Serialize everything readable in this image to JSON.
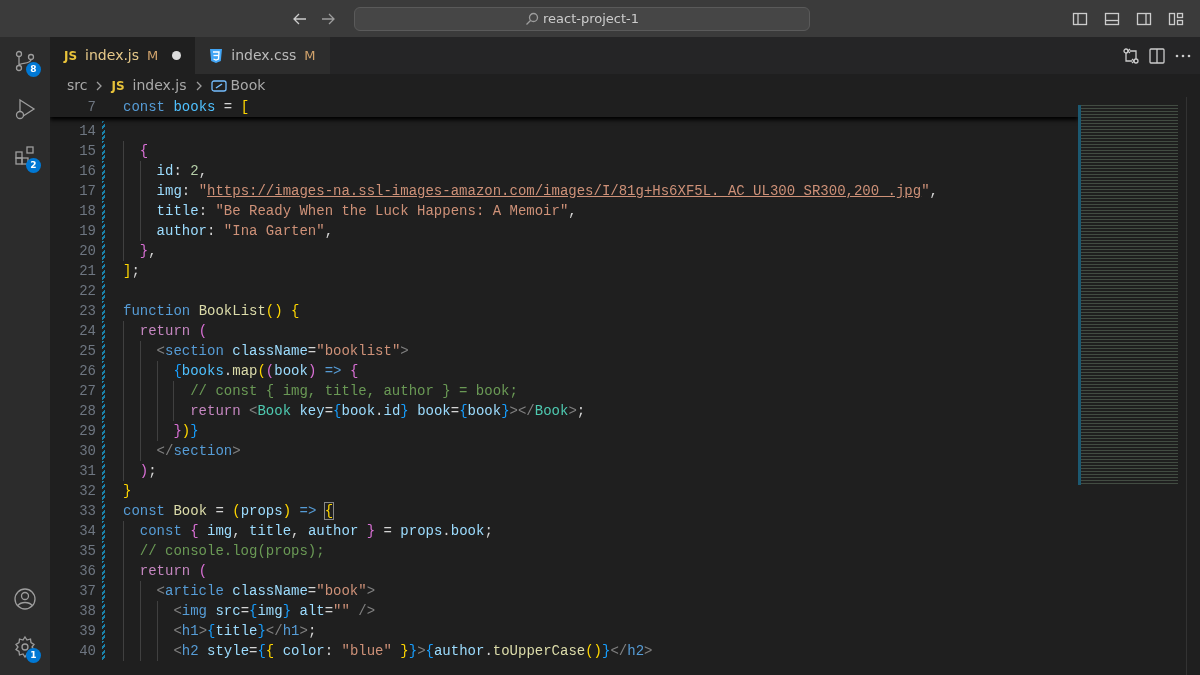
{
  "title_bar": {
    "search": {
      "value": "react-project-1"
    }
  },
  "activity_bar": {
    "top": [
      {
        "kind": "source-control",
        "badge": "8"
      },
      {
        "kind": "run-debug"
      },
      {
        "kind": "extensions",
        "badge": "2"
      }
    ],
    "bottom": [
      {
        "kind": "account"
      },
      {
        "kind": "settings",
        "badge": "1"
      }
    ]
  },
  "tabs": [
    {
      "kind": "js",
      "icon_text": "JS",
      "label": "index.js",
      "status": "M",
      "dirty": true,
      "selected": true
    },
    {
      "kind": "css",
      "label": "index.css",
      "status": "M",
      "dirty": false,
      "selected": false
    }
  ],
  "breadcrumb": [
    {
      "kind": "folder",
      "label": "src"
    },
    {
      "kind": "js",
      "icon_text": "JS",
      "label": "index.js"
    },
    {
      "kind": "symbol",
      "label": "Book"
    }
  ],
  "sticky_line": {
    "number": "7",
    "tokens": [
      {
        "text": "const ",
        "kind": "kw"
      },
      {
        "text": "books",
        "kind": "cnst"
      },
      {
        "text": " = ",
        "kind": "p"
      },
      {
        "text": "[",
        "kind": "b1"
      }
    ]
  },
  "lines": [
    {
      "number": "14",
      "modified": true
    },
    {
      "number": "15",
      "modified": true,
      "tokens": [
        {
          "text": "  {",
          "kind": "b2"
        }
      ]
    },
    {
      "number": "16",
      "modified": true,
      "tokens": [
        {
          "text": "    id",
          "kind": "var"
        },
        {
          "text": ": ",
          "kind": "p"
        },
        {
          "text": "2",
          "kind": "num"
        },
        {
          "text": ",",
          "kind": "p"
        }
      ]
    },
    {
      "number": "17",
      "modified": true,
      "tokens": [
        {
          "text": "    img",
          "kind": "var"
        },
        {
          "text": ": ",
          "kind": "p"
        },
        {
          "text": "\"",
          "kind": "str"
        },
        {
          "text": "https://images-na.ssl-images-amazon.com/images/I/81g+Hs6XF5L._AC_UL300_SR300,200_.jpg",
          "kind": "link"
        },
        {
          "text": "\"",
          "kind": "str"
        },
        {
          "text": ",",
          "kind": "p"
        }
      ]
    },
    {
      "number": "18",
      "modified": true,
      "tokens": [
        {
          "text": "    title",
          "kind": "var"
        },
        {
          "text": ": ",
          "kind": "p"
        },
        {
          "text": "\"Be Ready When the Luck Happens: A Memoir\"",
          "kind": "str"
        },
        {
          "text": ",",
          "kind": "p"
        }
      ]
    },
    {
      "number": "19",
      "modified": true,
      "tokens": [
        {
          "text": "    author",
          "kind": "var"
        },
        {
          "text": ": ",
          "kind": "p"
        },
        {
          "text": "\"Ina Garten\"",
          "kind": "str"
        },
        {
          "text": ",",
          "kind": "p"
        }
      ]
    },
    {
      "number": "20",
      "modified": true,
      "tokens": [
        {
          "text": "  }",
          "kind": "b2"
        },
        {
          "text": ",",
          "kind": "p"
        }
      ]
    },
    {
      "number": "21",
      "modified": true,
      "tokens": [
        {
          "text": "]",
          "kind": "b1"
        },
        {
          "text": ";",
          "kind": "p"
        }
      ]
    },
    {
      "number": "22",
      "modified": true
    },
    {
      "number": "23",
      "modified": true,
      "tokens": [
        {
          "text": "function ",
          "kind": "kw"
        },
        {
          "text": "BookList",
          "kind": "fn"
        },
        {
          "text": "() {",
          "kind": "b1"
        }
      ]
    },
    {
      "number": "24",
      "modified": true,
      "tokens": [
        {
          "text": "  return ",
          "kind": "ctl"
        },
        {
          "text": "(",
          "kind": "b2"
        }
      ]
    },
    {
      "number": "25",
      "modified": true,
      "tokens": [
        {
          "text": "    <",
          "kind": "tagp"
        },
        {
          "text": "section ",
          "kind": "tag"
        },
        {
          "text": "className",
          "kind": "var"
        },
        {
          "text": "=",
          "kind": "p"
        },
        {
          "text": "\"booklist\"",
          "kind": "str"
        },
        {
          "text": ">",
          "kind": "tagp"
        }
      ]
    },
    {
      "number": "26",
      "modified": true,
      "tokens": [
        {
          "text": "      {",
          "kind": "b3"
        },
        {
          "text": "books",
          "kind": "cnst"
        },
        {
          "text": ".",
          "kind": "p"
        },
        {
          "text": "map",
          "kind": "fn"
        },
        {
          "text": "(",
          "kind": "b1"
        },
        {
          "text": "(",
          "kind": "b2"
        },
        {
          "text": "book",
          "kind": "var"
        },
        {
          "text": ") ",
          "kind": "b2"
        },
        {
          "text": "=> ",
          "kind": "kw"
        },
        {
          "text": "{",
          "kind": "b2"
        }
      ]
    },
    {
      "number": "27",
      "modified": true,
      "tokens": [
        {
          "text": "        // const { img, title, author } = book;",
          "kind": "cmt"
        }
      ]
    },
    {
      "number": "28",
      "modified": true,
      "tokens": [
        {
          "text": "        return ",
          "kind": "ctl"
        },
        {
          "text": "<",
          "kind": "tagp"
        },
        {
          "text": "Book ",
          "kind": "comp"
        },
        {
          "text": "key",
          "kind": "var"
        },
        {
          "text": "=",
          "kind": "p"
        },
        {
          "text": "{",
          "kind": "b3"
        },
        {
          "text": "book",
          "kind": "var"
        },
        {
          "text": ".",
          "kind": "p"
        },
        {
          "text": "id",
          "kind": "var"
        },
        {
          "text": "} ",
          "kind": "b3"
        },
        {
          "text": "book",
          "kind": "var"
        },
        {
          "text": "=",
          "kind": "p"
        },
        {
          "text": "{",
          "kind": "b3"
        },
        {
          "text": "book",
          "kind": "var"
        },
        {
          "text": "}",
          "kind": "b3"
        },
        {
          "text": "></",
          "kind": "tagp"
        },
        {
          "text": "Book",
          "kind": "comp"
        },
        {
          "text": ">",
          "kind": "tagp"
        },
        {
          "text": ";",
          "kind": "p"
        }
      ]
    },
    {
      "number": "29",
      "modified": true,
      "tokens": [
        {
          "text": "      }",
          "kind": "b2"
        },
        {
          "text": ")",
          "kind": "b1"
        },
        {
          "text": "}",
          "kind": "b3"
        }
      ]
    },
    {
      "number": "30",
      "modified": true,
      "tokens": [
        {
          "text": "    </",
          "kind": "tagp"
        },
        {
          "text": "section",
          "kind": "tag"
        },
        {
          "text": ">",
          "kind": "tagp"
        }
      ]
    },
    {
      "number": "31",
      "modified": true,
      "tokens": [
        {
          "text": "  )",
          "kind": "b2"
        },
        {
          "text": ";",
          "kind": "p"
        }
      ]
    },
    {
      "number": "32",
      "modified": true,
      "tokens": [
        {
          "text": "}",
          "kind": "b1"
        }
      ]
    },
    {
      "number": "33",
      "modified": true,
      "tokens": [
        {
          "text": "const ",
          "kind": "kw"
        },
        {
          "text": "Book",
          "kind": "fn"
        },
        {
          "text": " = ",
          "kind": "p"
        },
        {
          "text": "(",
          "kind": "b1"
        },
        {
          "text": "props",
          "kind": "var"
        },
        {
          "text": ") ",
          "kind": "b1"
        },
        {
          "text": "=> ",
          "kind": "kw"
        },
        {
          "text": "{",
          "kind": "b1m"
        }
      ]
    },
    {
      "number": "34",
      "modified": true,
      "tokens": [
        {
          "text": "  const ",
          "kind": "kw"
        },
        {
          "text": "{ ",
          "kind": "b2"
        },
        {
          "text": "img",
          "kind": "var"
        },
        {
          "text": ", ",
          "kind": "p"
        },
        {
          "text": "title",
          "kind": "var"
        },
        {
          "text": ", ",
          "kind": "p"
        },
        {
          "text": "author",
          "kind": "var"
        },
        {
          "text": " }",
          "kind": "b2"
        },
        {
          "text": " = ",
          "kind": "p"
        },
        {
          "text": "props",
          "kind": "var"
        },
        {
          "text": ".",
          "kind": "p"
        },
        {
          "text": "book",
          "kind": "var"
        },
        {
          "text": ";",
          "kind": "p"
        }
      ]
    },
    {
      "number": "35",
      "modified": true,
      "tokens": [
        {
          "text": "  // console.log(props);",
          "kind": "cmt"
        }
      ]
    },
    {
      "number": "36",
      "modified": true,
      "tokens": [
        {
          "text": "  return ",
          "kind": "ctl"
        },
        {
          "text": "(",
          "kind": "b2"
        }
      ]
    },
    {
      "number": "37",
      "modified": true,
      "tokens": [
        {
          "text": "    <",
          "kind": "tagp"
        },
        {
          "text": "article ",
          "kind": "tag"
        },
        {
          "text": "className",
          "kind": "var"
        },
        {
          "text": "=",
          "kind": "p"
        },
        {
          "text": "\"book\"",
          "kind": "str"
        },
        {
          "text": ">",
          "kind": "tagp"
        }
      ]
    },
    {
      "number": "38",
      "modified": true,
      "tokens": [
        {
          "text": "      <",
          "kind": "tagp"
        },
        {
          "text": "img ",
          "kind": "tag"
        },
        {
          "text": "src",
          "kind": "var"
        },
        {
          "text": "=",
          "kind": "p"
        },
        {
          "text": "{",
          "kind": "b3"
        },
        {
          "text": "img",
          "kind": "var"
        },
        {
          "text": "} ",
          "kind": "b3"
        },
        {
          "text": "alt",
          "kind": "var"
        },
        {
          "text": "=",
          "kind": "p"
        },
        {
          "text": "\"\"",
          "kind": "str"
        },
        {
          "text": " />",
          "kind": "tagp"
        }
      ]
    },
    {
      "number": "39",
      "modified": true,
      "tokens": [
        {
          "text": "      <",
          "kind": "tagp"
        },
        {
          "text": "h1",
          "kind": "tag"
        },
        {
          "text": ">",
          "kind": "tagp"
        },
        {
          "text": "{",
          "kind": "b3"
        },
        {
          "text": "title",
          "kind": "var"
        },
        {
          "text": "}",
          "kind": "b3"
        },
        {
          "text": "</",
          "kind": "tagp"
        },
        {
          "text": "h1",
          "kind": "tag"
        },
        {
          "text": ">",
          "kind": "tagp"
        },
        {
          "text": ";",
          "kind": "p"
        }
      ]
    },
    {
      "number": "40",
      "modified": true,
      "tokens": [
        {
          "text": "      <",
          "kind": "tagp"
        },
        {
          "text": "h2 ",
          "kind": "tag"
        },
        {
          "text": "style",
          "kind": "var"
        },
        {
          "text": "=",
          "kind": "p"
        },
        {
          "text": "{",
          "kind": "b3"
        },
        {
          "text": "{ ",
          "kind": "b1"
        },
        {
          "text": "color",
          "kind": "var"
        },
        {
          "text": ": ",
          "kind": "p"
        },
        {
          "text": "\"blue\"",
          "kind": "str"
        },
        {
          "text": " }",
          "kind": "b1"
        },
        {
          "text": "}",
          "kind": "b3"
        },
        {
          "text": ">",
          "kind": "tagp"
        },
        {
          "text": "{",
          "kind": "b3"
        },
        {
          "text": "author",
          "kind": "var"
        },
        {
          "text": ".",
          "kind": "p"
        },
        {
          "text": "toUpperCase",
          "kind": "fn"
        },
        {
          "text": "()",
          "kind": "b1"
        },
        {
          "text": "}",
          "kind": "b3"
        },
        {
          "text": "</",
          "kind": "tagp"
        },
        {
          "text": "h2",
          "kind": "tag"
        },
        {
          "text": ">",
          "kind": "tagp"
        }
      ]
    }
  ]
}
